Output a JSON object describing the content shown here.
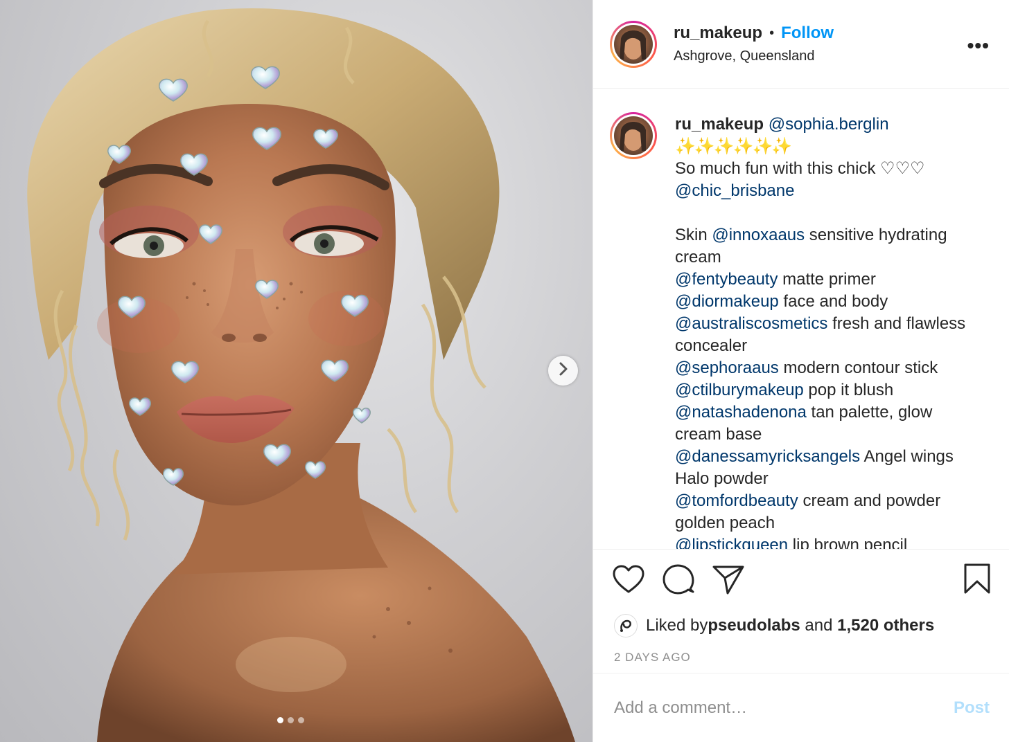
{
  "post": {
    "photo_alt": "",
    "carousel": {
      "slide_count": 3,
      "active_index": 0,
      "next_icon": "chevron-right-icon"
    }
  },
  "header": {
    "username": "ru_makeup",
    "bullet": "•",
    "follow_label": "Follow",
    "location": "Ashgrove, Queensland",
    "more_label": "•••",
    "more_icon": "more-options-icon"
  },
  "caption": {
    "username": "ru_makeup",
    "lines": [
      {
        "kind": "mention",
        "text": "@sophia.berglin",
        "after": ""
      },
      {
        "kind": "sparkles",
        "text": "✨✨✨✨✨✨"
      },
      {
        "kind": "plain",
        "text": "So much fun with this chick ♡♡♡"
      },
      {
        "kind": "mention",
        "text": "@chic_brisbane",
        "after": ""
      },
      {
        "kind": "blank"
      },
      {
        "kind": "mixed",
        "before": "Skin ",
        "text": "@innoxaaus",
        "after": " sensitive hydrating cream"
      },
      {
        "kind": "mention",
        "text": "@fentybeauty",
        "after": " matte primer"
      },
      {
        "kind": "mention",
        "text": "@diormakeup",
        "after": " face and body"
      },
      {
        "kind": "mention",
        "text": "@australiscosmetics",
        "after": " fresh and flawless concealer"
      },
      {
        "kind": "mention",
        "text": "@sephoraaus",
        "after": " modern contour stick"
      },
      {
        "kind": "mention",
        "text": "@ctilburymakeup",
        "after": " pop it blush"
      },
      {
        "kind": "mention",
        "text": "@natashadenona",
        "after": " tan palette, glow cream base"
      },
      {
        "kind": "mention",
        "text": "@danessamyricksangels",
        "after": " Angel wings Halo powder"
      },
      {
        "kind": "mention",
        "text": "@tomfordbeauty",
        "after": " cream and powder golden peach"
      },
      {
        "kind": "mention",
        "text": "@lipstickqueen",
        "after": " lip brown pencil"
      }
    ]
  },
  "actions": {
    "like_icon": "heart-icon",
    "comment_icon": "comment-icon",
    "share_icon": "paper-plane-icon",
    "save_icon": "bookmark-icon"
  },
  "likes": {
    "prefix": "Liked by ",
    "liker": "pseudolabs",
    "middle": " and ",
    "count": "1,520 others"
  },
  "timestamp": "2 DAYS AGO",
  "comment": {
    "placeholder": "Add a comment…",
    "post_label": "Post"
  },
  "colors": {
    "link_blue": "#0095f6",
    "mention": "#00376b",
    "post_disabled": "#b2dffc",
    "meta_grey": "#8e8e8e"
  }
}
